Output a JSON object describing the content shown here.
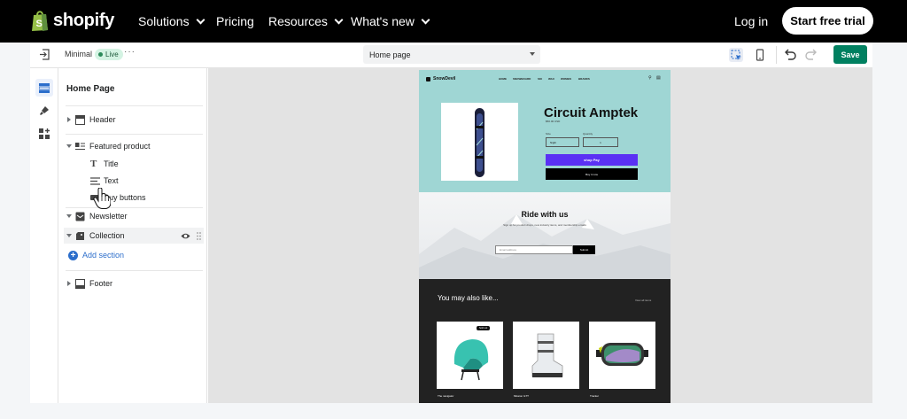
{
  "site_nav": {
    "logo_text": "shopify",
    "items": [
      "Solutions",
      "Pricing",
      "Resources",
      "What's new"
    ],
    "login": "Log in",
    "cta": "Start free trial"
  },
  "toolbar": {
    "theme_name": "Minimal",
    "status": "Live",
    "more": "···",
    "page_selector": "Home page",
    "save_label": "Save"
  },
  "sidebar": {
    "title": "Home Page",
    "sections": [
      {
        "label": "Header"
      },
      {
        "label": "Featured product",
        "blocks": [
          "Title",
          "Text",
          "Buy buttons"
        ]
      },
      {
        "label": "Newsletter"
      },
      {
        "label": "Collection"
      }
    ],
    "add_section": "Add section",
    "footer": "Footer"
  },
  "preview": {
    "store_logo": "SnowDevil",
    "nav": [
      "HOME",
      "SNOWBOARD",
      "SKI",
      "WAX",
      "WOMEN",
      "BRANDS"
    ],
    "product": {
      "title": "Circuit Amptek",
      "price": "$50.00 USD",
      "size_label": "Size",
      "size_value": "Night",
      "qty_label": "Quantity",
      "qty_value": "1",
      "shop_pay": "shop Pay",
      "buy_now": "Buy it now"
    },
    "newsletter": {
      "title": "Ride with us",
      "subtitle": "Sign up for product drops, new industry items, and membership emails",
      "email_placeholder": "Email address",
      "submit": "Submit"
    },
    "recommendations": {
      "title": "You may also like...",
      "link": "View all items",
      "products": [
        {
          "name": "The navigator",
          "badge": "Sold out"
        },
        {
          "name": "Mission GTT",
          "badge": ""
        },
        {
          "name": "Tracker",
          "badge": ""
        }
      ]
    }
  },
  "colors": {
    "brand_green": "#008060",
    "hero_bg": "#9fd6d4",
    "shop_pay": "#5a31f4",
    "link_blue": "#2c6ecb"
  }
}
